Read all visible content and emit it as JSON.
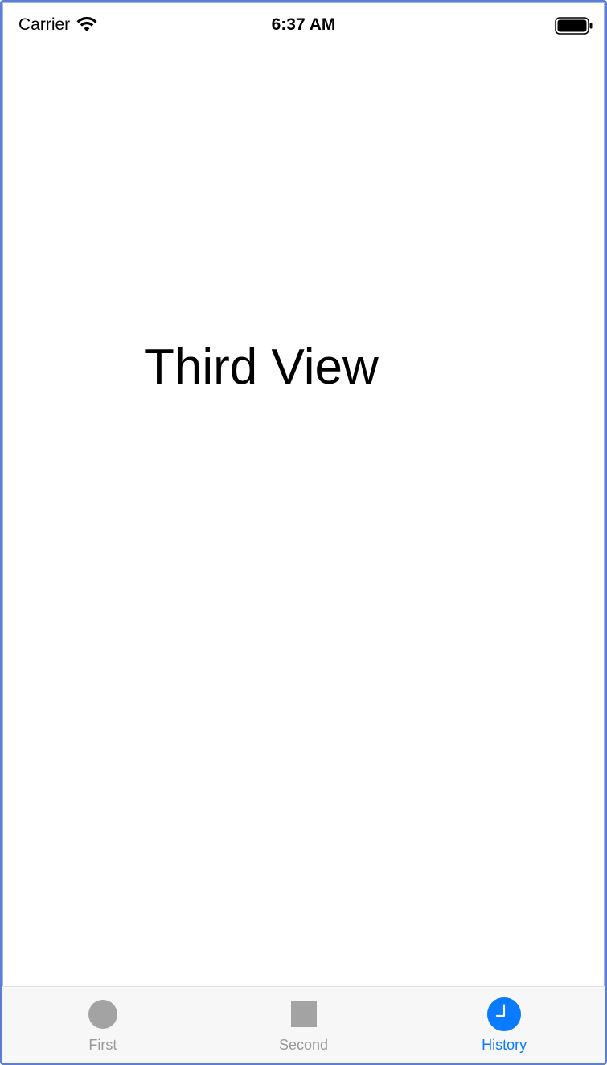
{
  "status_bar": {
    "carrier": "Carrier",
    "time": "6:37 AM"
  },
  "main": {
    "label": "Third View"
  },
  "tab_bar": {
    "tabs": [
      {
        "label": "First",
        "icon": "circle-icon",
        "selected": false
      },
      {
        "label": "Second",
        "icon": "square-icon",
        "selected": false
      },
      {
        "label": "History",
        "icon": "clock-icon",
        "selected": true
      }
    ]
  },
  "colors": {
    "accent": "#0a7aff",
    "inactive": "#999999",
    "tab_bar_background": "#f7f7f7",
    "frame_border": "#5b7fd6"
  }
}
